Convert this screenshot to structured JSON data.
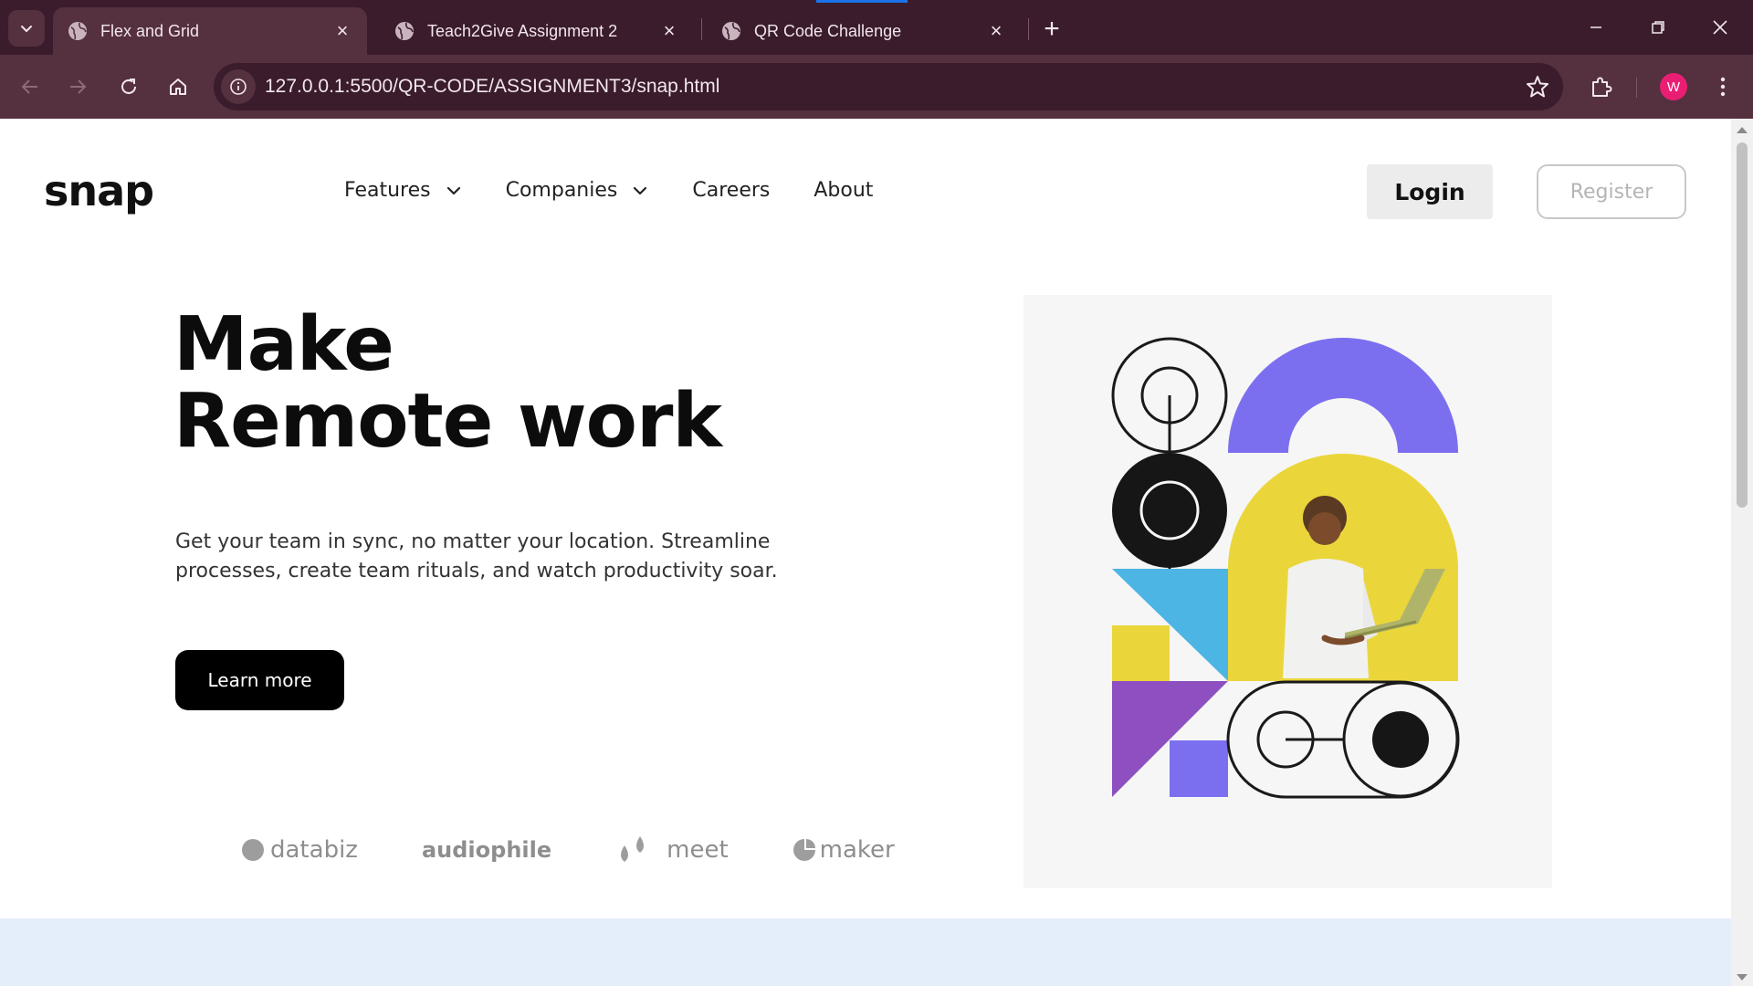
{
  "browser": {
    "tabs": [
      {
        "title": "Flex and Grid",
        "active": true
      },
      {
        "title": "Teach2Give Assignment 2",
        "active": false
      },
      {
        "title": "QR Code Challenge",
        "active": false
      }
    ],
    "url": "127.0.0.1:5500/QR-CODE/ASSIGNMENT3/snap.html",
    "profile_initial": "W",
    "colors": {
      "frame": "#3a1c2c",
      "toolbar": "#55303f",
      "avatar": "#e91e73"
    }
  },
  "page": {
    "logo": "snap",
    "nav": {
      "features": "Features",
      "companies": "Companies",
      "careers": "Careers",
      "about": "About"
    },
    "login_label": "Login",
    "register_label": "Register",
    "hero": {
      "title_line1": "Make",
      "title_line2": "Remote work",
      "subtitle": "Get your team in sync, no matter your location. Streamline processes, create team rituals, and watch productivity soar.",
      "cta_label": "Learn more"
    },
    "clients": {
      "databiz": "databiz",
      "audiophile_top": "audio",
      "audiophile_bottom": "phile",
      "meet": "meet",
      "maker": "maker"
    },
    "colors": {
      "accent_purple": "#7b6ff0",
      "accent_yellow": "#ead63a",
      "accent_blue": "#4cb5e4",
      "footer_band": "#e4eefb"
    }
  }
}
